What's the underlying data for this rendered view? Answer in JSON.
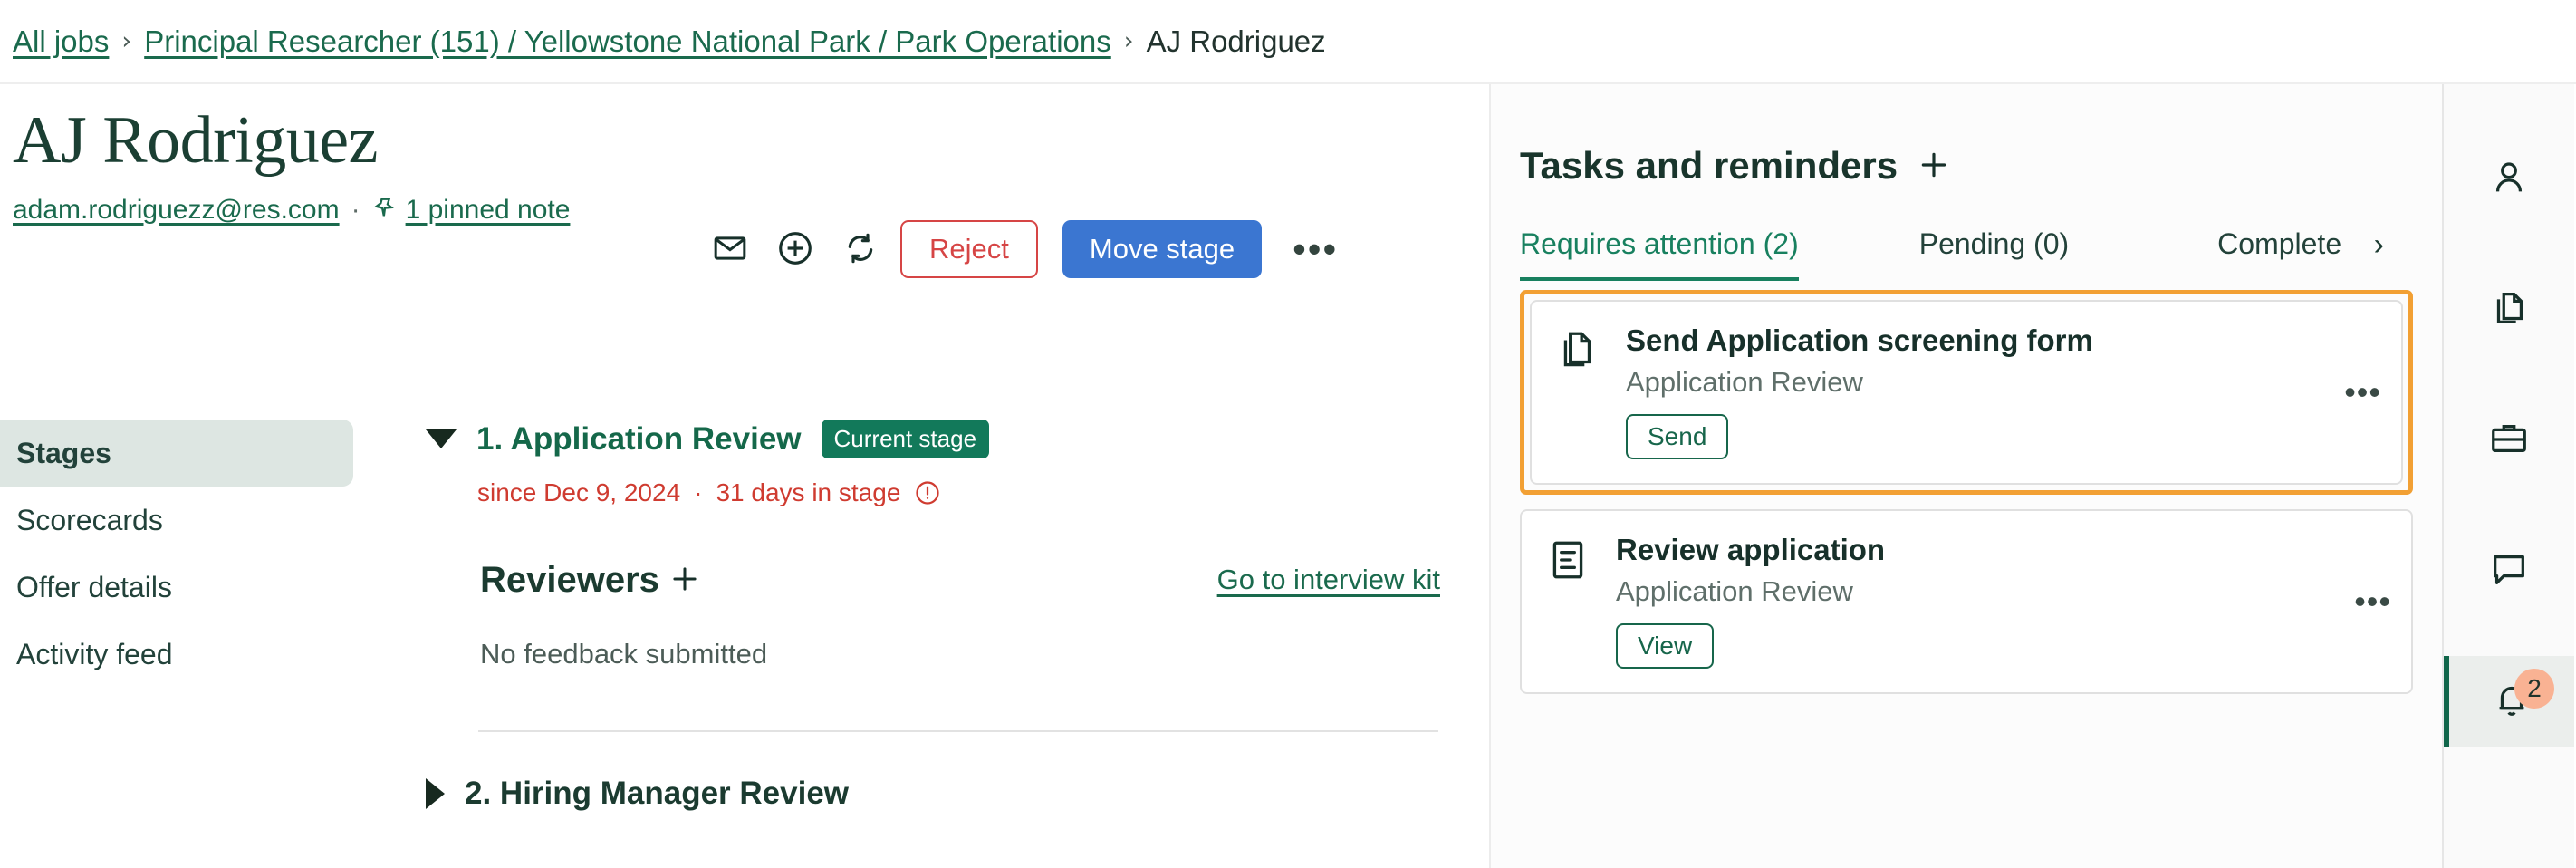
{
  "breadcrumb": {
    "all_jobs": "All jobs",
    "job_path": "Principal Researcher (151) / Yellowstone National Park / Park Operations",
    "current": "AJ Rodriguez",
    "separator": "›"
  },
  "candidate": {
    "name": "AJ Rodriguez",
    "email": "adam.rodriguezz@res.com",
    "dot": "·",
    "pinned_note": "1 pinned note"
  },
  "header_actions": {
    "email_icon": "envelope-icon",
    "add_icon": "plus-circle-icon",
    "sync_icon": "refresh-icon",
    "reject_label": "Reject",
    "move_stage_label": "Move stage",
    "more_label": "•••",
    "reject_color": "#d64545",
    "move_stage_color": "#3b76d1"
  },
  "sidebar": {
    "items": [
      {
        "label": "Stages",
        "active": true
      },
      {
        "label": "Scorecards",
        "active": false
      },
      {
        "label": "Offer details",
        "active": false
      },
      {
        "label": "Activity feed",
        "active": false
      }
    ]
  },
  "stages": {
    "stage1": {
      "title": "1. Application Review",
      "badge": "Current stage",
      "badge_color": "#12795a",
      "since": "since Dec 9, 2024",
      "meta_dot": "·",
      "days_in_stage": "31 days in stage",
      "meta_color": "#cf3b30",
      "reviewers_title": "Reviewers",
      "no_feedback": "No feedback submitted",
      "interview_kit_link": "Go to interview kit"
    },
    "stage2": {
      "title": "2. Hiring Manager Review"
    }
  },
  "tasks": {
    "title": "Tasks and reminders",
    "add_icon": "plus-icon",
    "tabs": [
      {
        "label": "Requires attention (2)",
        "active": true
      },
      {
        "label": "Pending (0)",
        "active": false
      },
      {
        "label": "Complete",
        "active": false
      }
    ],
    "scroll_chevron": "›",
    "highlight_color": "#f2a034",
    "items": [
      {
        "name": "Send Application screening form",
        "stage": "Application Review",
        "action": "Send",
        "icon": "copy-document-icon",
        "more": "•••",
        "highlighted": true
      },
      {
        "name": "Review application",
        "stage": "Application Review",
        "action": "View",
        "icon": "document-lines-icon",
        "more": "•••",
        "highlighted": false
      }
    ]
  },
  "rail": {
    "items": [
      {
        "icon": "person-icon",
        "active": false,
        "badge": null
      },
      {
        "icon": "documents-icon",
        "active": false,
        "badge": null
      },
      {
        "icon": "briefcase-icon",
        "active": false,
        "badge": null
      },
      {
        "icon": "chat-bubble-icon",
        "active": false,
        "badge": null
      },
      {
        "icon": "bell-icon",
        "active": true,
        "badge": "2"
      }
    ],
    "badge_color": "#f9b293"
  }
}
